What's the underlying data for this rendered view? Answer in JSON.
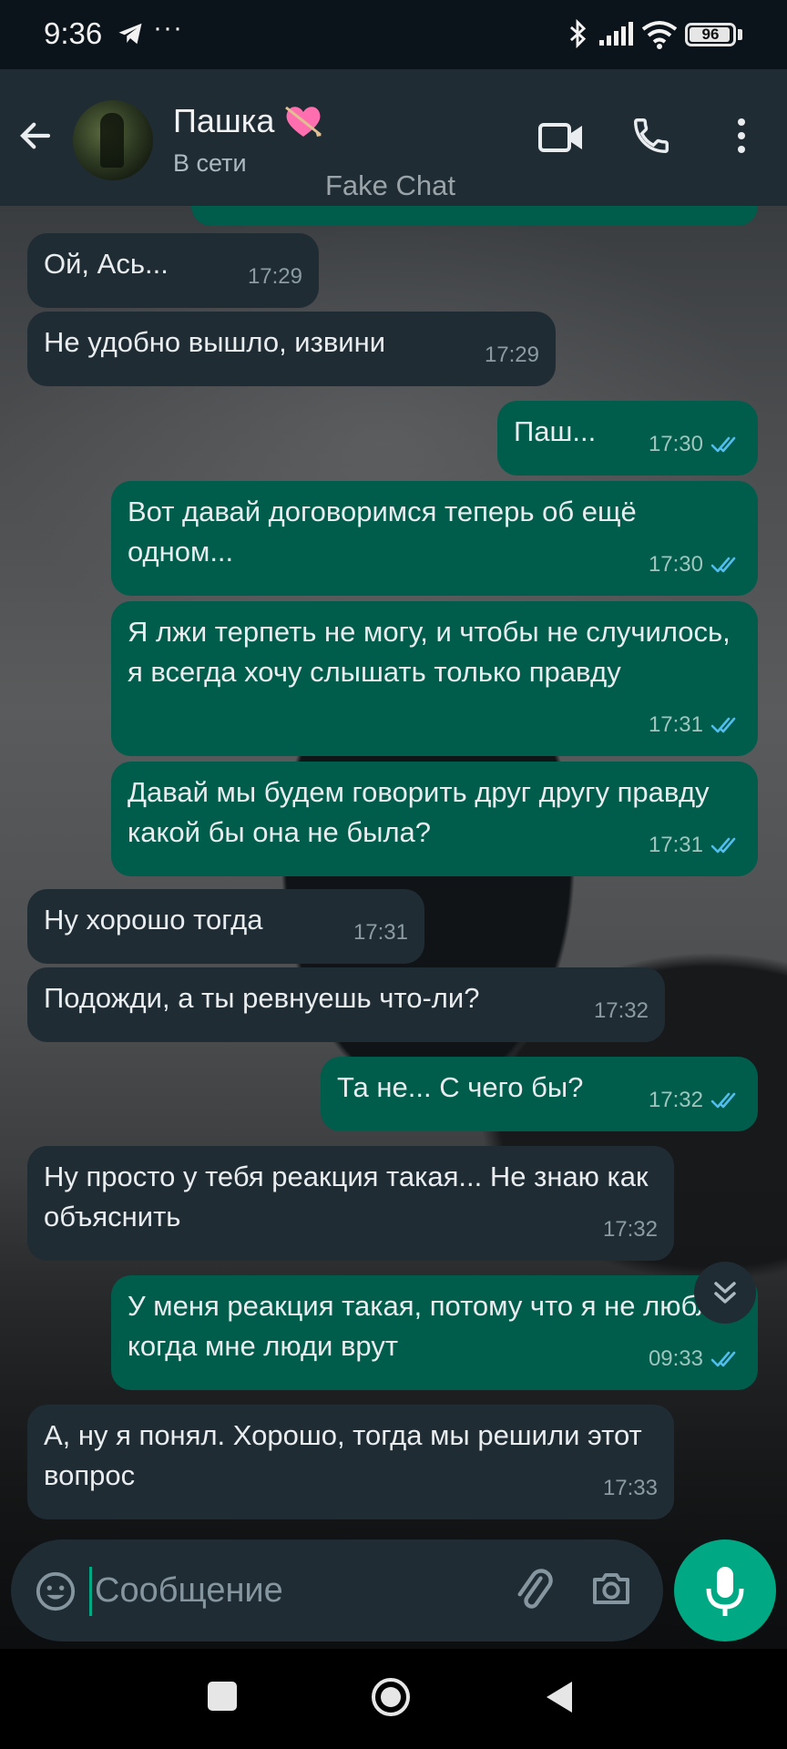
{
  "status_bar": {
    "time": "9:36",
    "dots": "···",
    "battery": "96"
  },
  "header": {
    "contact_name": "Пашка",
    "contact_status": "В сети",
    "watermark": "Fake Chat"
  },
  "messages": [
    {
      "dir": "in",
      "text": "Ой, Ась...",
      "time": "17:29"
    },
    {
      "dir": "in",
      "text": "Не удобно вышло, извини",
      "time": "17:29"
    },
    {
      "dir": "out",
      "text": "Паш...",
      "time": "17:30",
      "read": true
    },
    {
      "dir": "out",
      "text": "Вот давай договоримся теперь об ещё одном...",
      "time": "17:30",
      "read": true
    },
    {
      "dir": "out",
      "text": "Я лжи терпеть не могу, и чтобы не случилось, я всегда хочу слышать только правду",
      "time": "17:31",
      "read": true
    },
    {
      "dir": "out",
      "text": "Давай мы будем говорить друг другу правду какой бы она не была?",
      "time": "17:31",
      "read": true
    },
    {
      "dir": "in",
      "text": "Ну хорошо тогда",
      "time": "17:31"
    },
    {
      "dir": "in",
      "text": "Подожди, а ты ревнуешь что-ли?",
      "time": "17:32"
    },
    {
      "dir": "out",
      "text": "Та не... С чего бы?",
      "time": "17:32",
      "read": true
    },
    {
      "dir": "in",
      "text": "Ну просто у тебя реакция такая... Не знаю как объяснить",
      "time": "17:32"
    },
    {
      "dir": "out",
      "text": "У меня реакция такая, потому что я не люблю когда мне люди врут",
      "time": "09:33",
      "read": true
    },
    {
      "dir": "in",
      "text": "А, ну я понял. Хорошо, тогда мы решили этот вопрос",
      "time": "17:33"
    }
  ],
  "composer": {
    "placeholder": "Сообщение",
    "value": ""
  },
  "icons": {
    "back": "arrow-left-icon",
    "video": "video-camera-icon",
    "call": "phone-icon",
    "more": "more-vertical-icon",
    "emoji": "emoji-icon",
    "attach": "paperclip-icon",
    "camera": "camera-icon",
    "mic": "microphone-icon",
    "scroll": "double-chevron-down-icon"
  },
  "colors": {
    "incoming": "#1f2c34",
    "outgoing": "#005c4b",
    "accent": "#00a884",
    "read_ticks": "#53bdeb"
  }
}
